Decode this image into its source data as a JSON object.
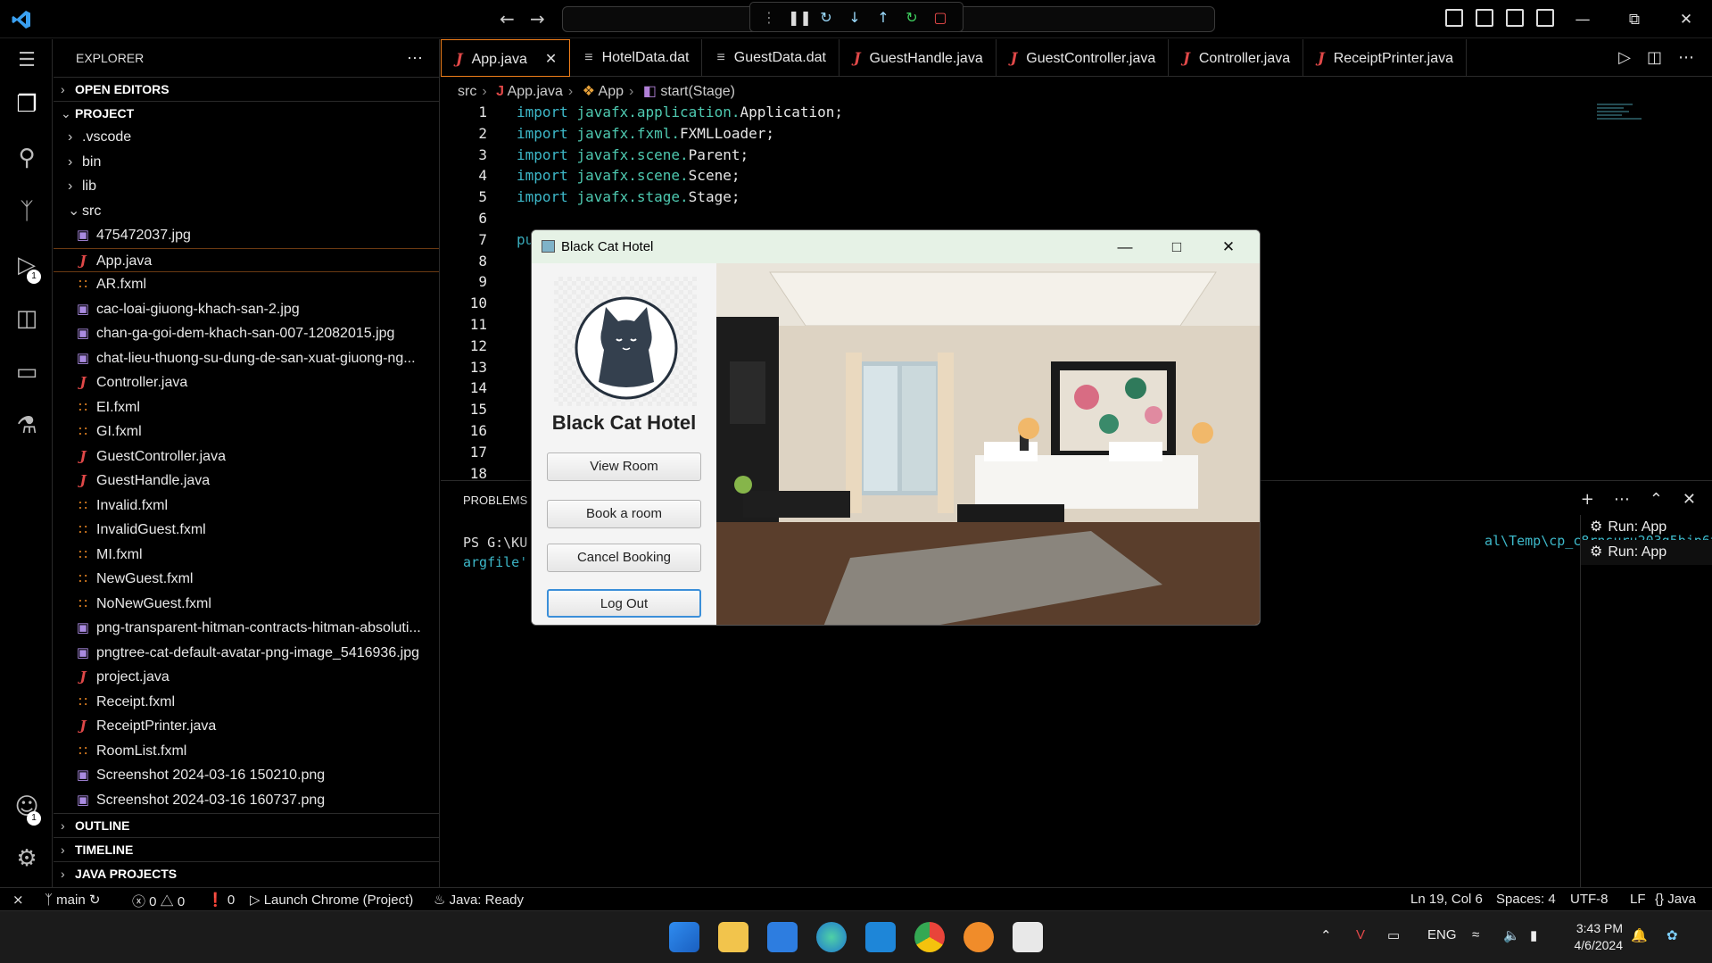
{
  "titlebar": {
    "back_icon": "arrow-left",
    "forward_icon": "arrow-right",
    "window_controls": [
      "minimize",
      "restore",
      "close"
    ]
  },
  "sidebar": {
    "title": "EXPLORER",
    "sections": {
      "open_editors": "OPEN EDITORS",
      "project": "PROJECT",
      "outline": "OUTLINE",
      "timeline": "TIMELINE",
      "java_projects": "JAVA PROJECTS"
    },
    "folders": [
      ".vscode",
      "bin",
      "lib"
    ],
    "src_label": "src",
    "files": [
      {
        "name": "475472037.jpg",
        "type": "img"
      },
      {
        "name": "App.java",
        "type": "java"
      },
      {
        "name": "AR.fxml",
        "type": "xml"
      },
      {
        "name": "cac-loai-giuong-khach-san-2.jpg",
        "type": "img"
      },
      {
        "name": "chan-ga-goi-dem-khach-san-007-12082015.jpg",
        "type": "img"
      },
      {
        "name": "chat-lieu-thuong-su-dung-de-san-xuat-giuong-ng...",
        "type": "img"
      },
      {
        "name": "Controller.java",
        "type": "java"
      },
      {
        "name": "EI.fxml",
        "type": "xml"
      },
      {
        "name": "GI.fxml",
        "type": "xml"
      },
      {
        "name": "GuestController.java",
        "type": "java"
      },
      {
        "name": "GuestHandle.java",
        "type": "java"
      },
      {
        "name": "Invalid.fxml",
        "type": "xml"
      },
      {
        "name": "InvalidGuest.fxml",
        "type": "xml"
      },
      {
        "name": "MI.fxml",
        "type": "xml"
      },
      {
        "name": "NewGuest.fxml",
        "type": "xml"
      },
      {
        "name": "NoNewGuest.fxml",
        "type": "xml"
      },
      {
        "name": "png-transparent-hitman-contracts-hitman-absoluti...",
        "type": "img"
      },
      {
        "name": "pngtree-cat-default-avatar-png-image_5416936.jpg",
        "type": "img"
      },
      {
        "name": "project.java",
        "type": "java"
      },
      {
        "name": "Receipt.fxml",
        "type": "xml"
      },
      {
        "name": "ReceiptPrinter.java",
        "type": "java"
      },
      {
        "name": "RoomList.fxml",
        "type": "xml"
      },
      {
        "name": "Screenshot 2024-03-16 150210.png",
        "type": "img"
      },
      {
        "name": "Screenshot 2024-03-16 160737.png",
        "type": "img"
      }
    ]
  },
  "tabs": [
    {
      "label": "App.java",
      "icon": "java"
    },
    {
      "label": "HotelData.dat",
      "icon": "dat"
    },
    {
      "label": "GuestData.dat",
      "icon": "dat"
    },
    {
      "label": "GuestHandle.java",
      "icon": "java"
    },
    {
      "label": "GuestController.java",
      "icon": "java"
    },
    {
      "label": "Controller.java",
      "icon": "java"
    },
    {
      "label": "ReceiptPrinter.java",
      "icon": "java"
    }
  ],
  "breadcrumb": {
    "src": "src",
    "file": "App.java",
    "class": "App",
    "method": "start(Stage)"
  },
  "code": {
    "line_numbers": [
      "1",
      "2",
      "3",
      "4",
      "5",
      "6",
      "7",
      "8",
      "9",
      "10",
      "11",
      "12",
      "13",
      "14",
      "15",
      "16",
      "17",
      "18"
    ],
    "imports": [
      {
        "kw": "import",
        "pkg": "javafx.application.",
        "cls": "Application;"
      },
      {
        "kw": "import",
        "pkg": "javafx.fxml.",
        "cls": "FXMLLoader;"
      },
      {
        "kw": "import",
        "pkg": "javafx.scene.",
        "cls": "Parent;"
      },
      {
        "kw": "import",
        "pkg": "javafx.scene.",
        "cls": "Scene;"
      },
      {
        "kw": "import",
        "pkg": "javafx.stage.",
        "cls": "Stage;"
      }
    ],
    "line7_partial": "pu"
  },
  "panel": {
    "tab": "PROBLEMS",
    "terminal_line1": "PS G:\\KU",
    "terminal_line2": "argfile'",
    "terminal_right": "al\\Temp\\cp_c8rnsuru203g5bjp6t3y3ethn.",
    "run_items": [
      "Run: App",
      "Run: App"
    ]
  },
  "statusbar": {
    "branch": "main",
    "errors": "0",
    "warnings": "0",
    "ports": "0",
    "launch": "Launch Chrome (Project)",
    "java": "Java: Ready",
    "position": "Ln 19, Col 6",
    "spaces": "Spaces: 4",
    "encoding": "UTF-8",
    "eol": "LF",
    "language": "Java"
  },
  "taskbar": {
    "lang": "ENG",
    "time": "3:43 PM",
    "date": "4/6/2024"
  },
  "fxwindow": {
    "title": "Black Cat Hotel",
    "hotel_name": "Black Cat Hotel",
    "buttons": {
      "view_room": "View Room",
      "book_room": "Book a room",
      "cancel_booking": "Cancel Booking",
      "log_out": "Log Out"
    }
  },
  "colors": {
    "accent": "#f07f1a",
    "keyword": "#3db8c9",
    "fx_focus": "#3b8fd9"
  }
}
